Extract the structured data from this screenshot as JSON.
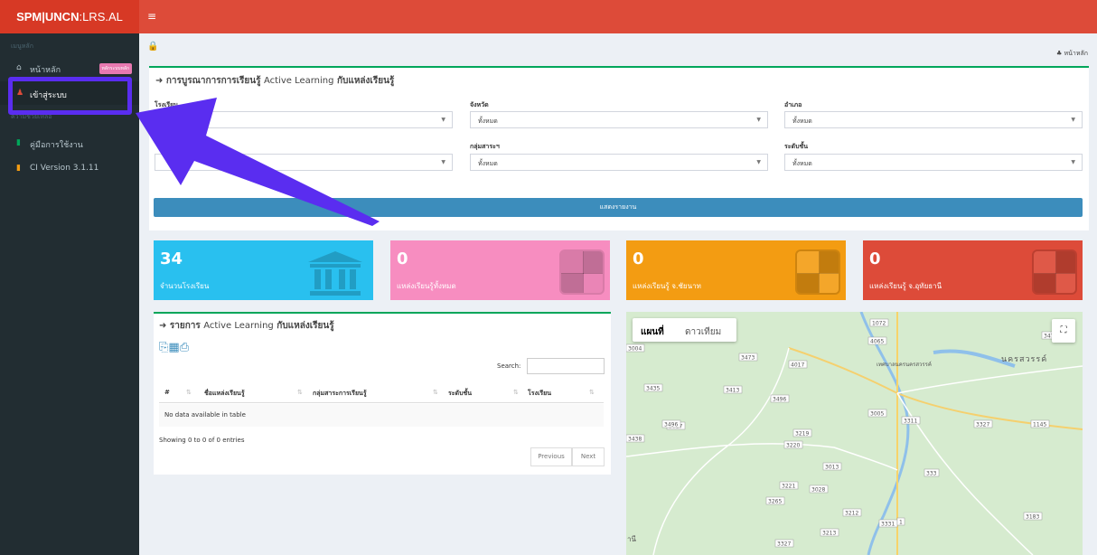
{
  "brand": {
    "bold": "SPM|UNCN",
    "rest": ":LRS.AL"
  },
  "topbar": {
    "menu_icon": "≡"
  },
  "sidebar": {
    "header_main": "เมนูหลัก",
    "items": [
      {
        "icon": "home-icon",
        "glyph": "⌂",
        "label": "หน้าหลัก",
        "badge": "หลักระบบหลัก"
      },
      {
        "icon": "user-icon",
        "glyph": "♟",
        "label": "เข้าสู่ระบบ"
      },
      {
        "icon": "book-icon",
        "glyph": "▮",
        "label": "คู่มือการใช้งาน"
      },
      {
        "icon": "book-icon",
        "glyph": "▮",
        "label": "CI Version 3.1.11"
      }
    ],
    "header_help": "ความช่วยเหลือ"
  },
  "breadcrumb": {
    "label": "หน้าหลัก",
    "icon": "sitemap-icon",
    "glyph": "♣"
  },
  "filter_box": {
    "title_prefix": "การบูรณาการการเรียนรู้",
    "title_mid": "Active Learning",
    "title_suffix": "กับแหล่งเรียนรู้",
    "fields": [
      {
        "label": "โรงเรียน",
        "value": ""
      },
      {
        "label": "จังหวัด",
        "value": "ทั้งหมด"
      },
      {
        "label": "อำเภอ",
        "value": "ทั้งหมด"
      },
      {
        "label": "",
        "value": ""
      },
      {
        "label": "กลุ่มสาระฯ",
        "value": "ทั้งหมด"
      },
      {
        "label": "ระดับชั้น",
        "value": "ทั้งหมด"
      }
    ],
    "submit_label": "แสดงรายงาน"
  },
  "stats": [
    {
      "number": "34",
      "label": "จำนวนโรงเรียน",
      "color": "#29c0ef"
    },
    {
      "number": "0",
      "label": "แหล่งเรียนรู้ทั้งหมด",
      "color": "#f78dc0"
    },
    {
      "number": "0",
      "label": "แหล่งเรียนรู้ จ.ชัยนาท",
      "color": "#f39c12"
    },
    {
      "number": "0",
      "label": "แหล่งเรียนรู้ จ.อุทัยธานี",
      "color": "#dd4b39"
    }
  ],
  "list_box": {
    "title_prefix": "รายการ",
    "title_mid": "Active Learning",
    "title_suffix": "กับแหล่งเรียนรู้",
    "search_label": "Search:",
    "columns": [
      "#",
      "ชื่อแหล่งเรียนรู้",
      "กลุ่มสาระการเรียนรู้",
      "ระดับชั้น",
      "โรงเรียน"
    ],
    "empty_text": "No data available in table",
    "info_text": "Showing 0 to 0 of 0 entries",
    "prev_label": "Previous",
    "next_label": "Next"
  },
  "map": {
    "tab_map": "แผนที่",
    "tab_satellite": "ดาวเทียม",
    "fullscreen_glyph": "⛶",
    "labels": {
      "city": "นครสวรรค์",
      "town": "เทศบาลนครนครสวรรค์",
      "edge": "านี"
    },
    "road_numbers": [
      "1072",
      "4065",
      "3475",
      "3004",
      "3473",
      "4017",
      "3435",
      "3413",
      "3496",
      "3017",
      "3005",
      "3311",
      "3327",
      "1145",
      "3438",
      "3496",
      "3219",
      "3220",
      "3013",
      "3221",
      "3028",
      "333",
      "3265",
      "3212",
      "3331",
      "3183",
      "3213",
      "3327",
      "1"
    ]
  }
}
